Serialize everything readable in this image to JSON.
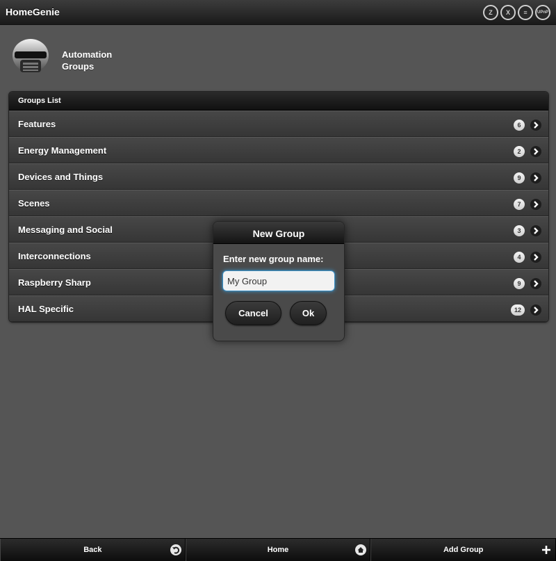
{
  "header": {
    "title": "HomeGenie",
    "icons": [
      {
        "name": "zwave-icon",
        "glyph": "Z"
      },
      {
        "name": "x10-icon",
        "glyph": "X"
      },
      {
        "name": "insteon-icon",
        "glyph": "≡"
      },
      {
        "name": "upnp-icon",
        "glyph": "UPnP"
      }
    ]
  },
  "page": {
    "title": "Automation Groups"
  },
  "groups": {
    "divider": "Groups List",
    "items": [
      {
        "label": "Features",
        "count": "6"
      },
      {
        "label": "Energy Management",
        "count": "2"
      },
      {
        "label": "Devices and Things",
        "count": "9"
      },
      {
        "label": "Scenes",
        "count": "7"
      },
      {
        "label": "Messaging and Social",
        "count": "3"
      },
      {
        "label": "Interconnections",
        "count": "4"
      },
      {
        "label": "Raspberry Sharp",
        "count": "9"
      },
      {
        "label": "HAL Specific",
        "count": "12"
      }
    ]
  },
  "dialog": {
    "title": "New Group",
    "prompt": "Enter new group name:",
    "input_value": "My Group",
    "cancel_label": "Cancel",
    "ok_label": "Ok"
  },
  "footer": {
    "back_label": "Back",
    "home_label": "Home",
    "add_group_label": "Add Group"
  },
  "colors": {
    "background": "#555555",
    "input_focus": "#3a8fc4"
  }
}
